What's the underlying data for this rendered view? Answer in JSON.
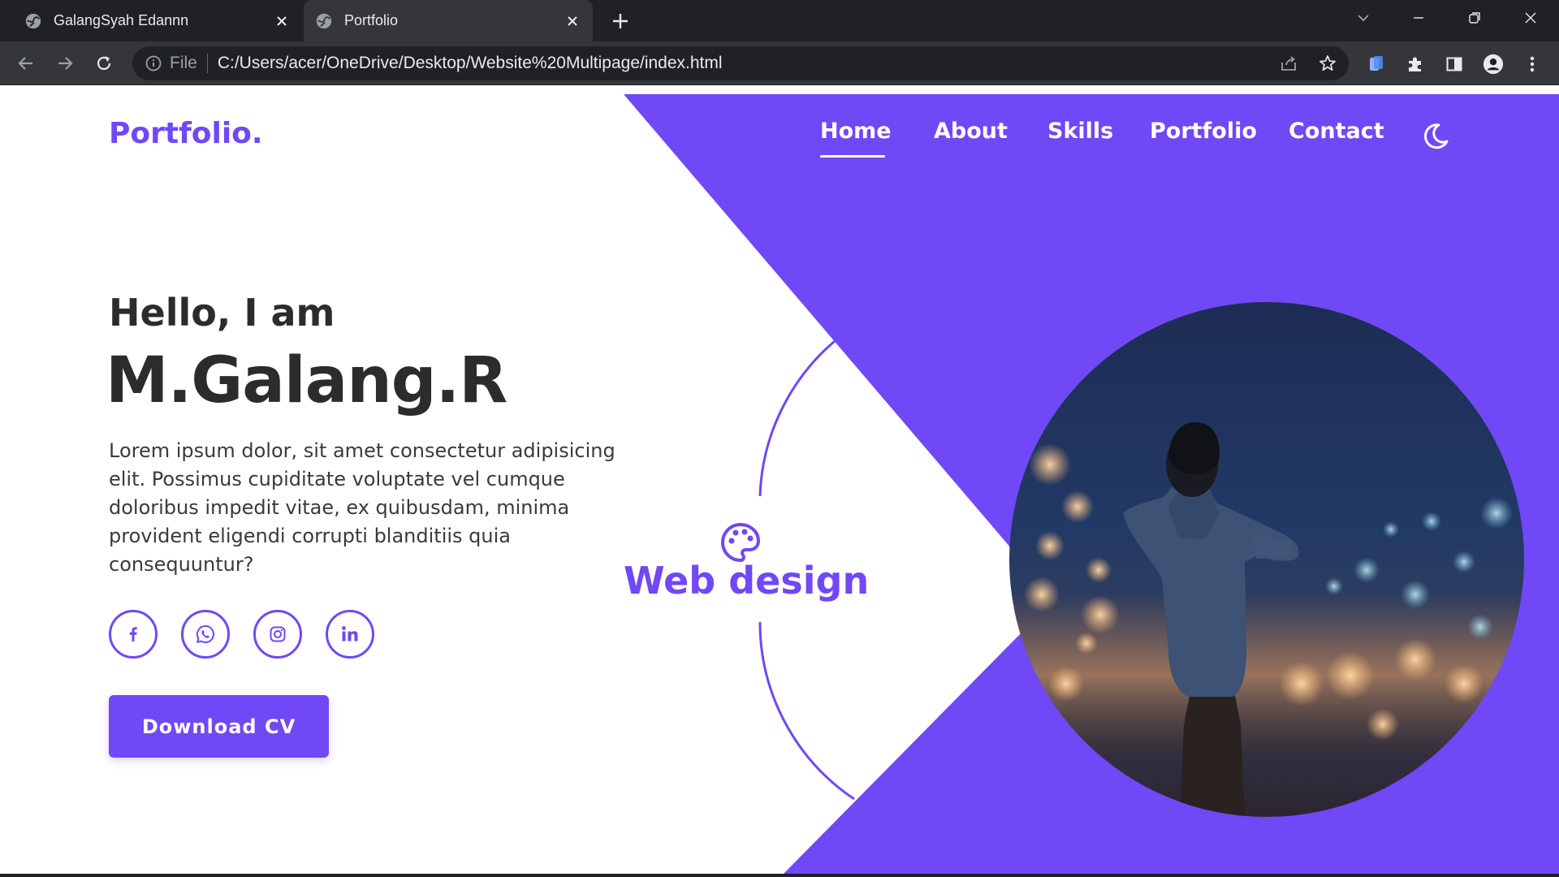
{
  "browser": {
    "tabs": [
      {
        "title": "GalangSyah Edannn",
        "active": false
      },
      {
        "title": "Portfolio",
        "active": true
      }
    ],
    "omnibox": {
      "scheme_label": "File",
      "url": "C:/Users/acer/OneDrive/Desktop/Website%20Multipage/index.html"
    }
  },
  "site": {
    "logo": "Portfolio.",
    "nav": [
      "Home",
      "About",
      "Skills",
      "Portfolio",
      "Contact"
    ],
    "active_nav": "Home",
    "hero": {
      "greeting": "Hello, I am",
      "name": "M.Galang.R",
      "description": "Lorem ipsum dolor, sit amet consectetur adipisicing elit. Possimus cupiditate voluptate vel cumque doloribus impedit vitae, ex quibusdam, minima provident eligendi corrupti blanditiis quia consequuntur?",
      "cta": "Download CV",
      "badge": "Web design",
      "social": [
        "facebook",
        "whatsapp",
        "instagram",
        "linkedin"
      ]
    }
  },
  "colors": {
    "accent": "#7048f5",
    "text": "#2c2c2c",
    "chrome_dark": "#202124",
    "chrome_mid": "#35363a"
  }
}
